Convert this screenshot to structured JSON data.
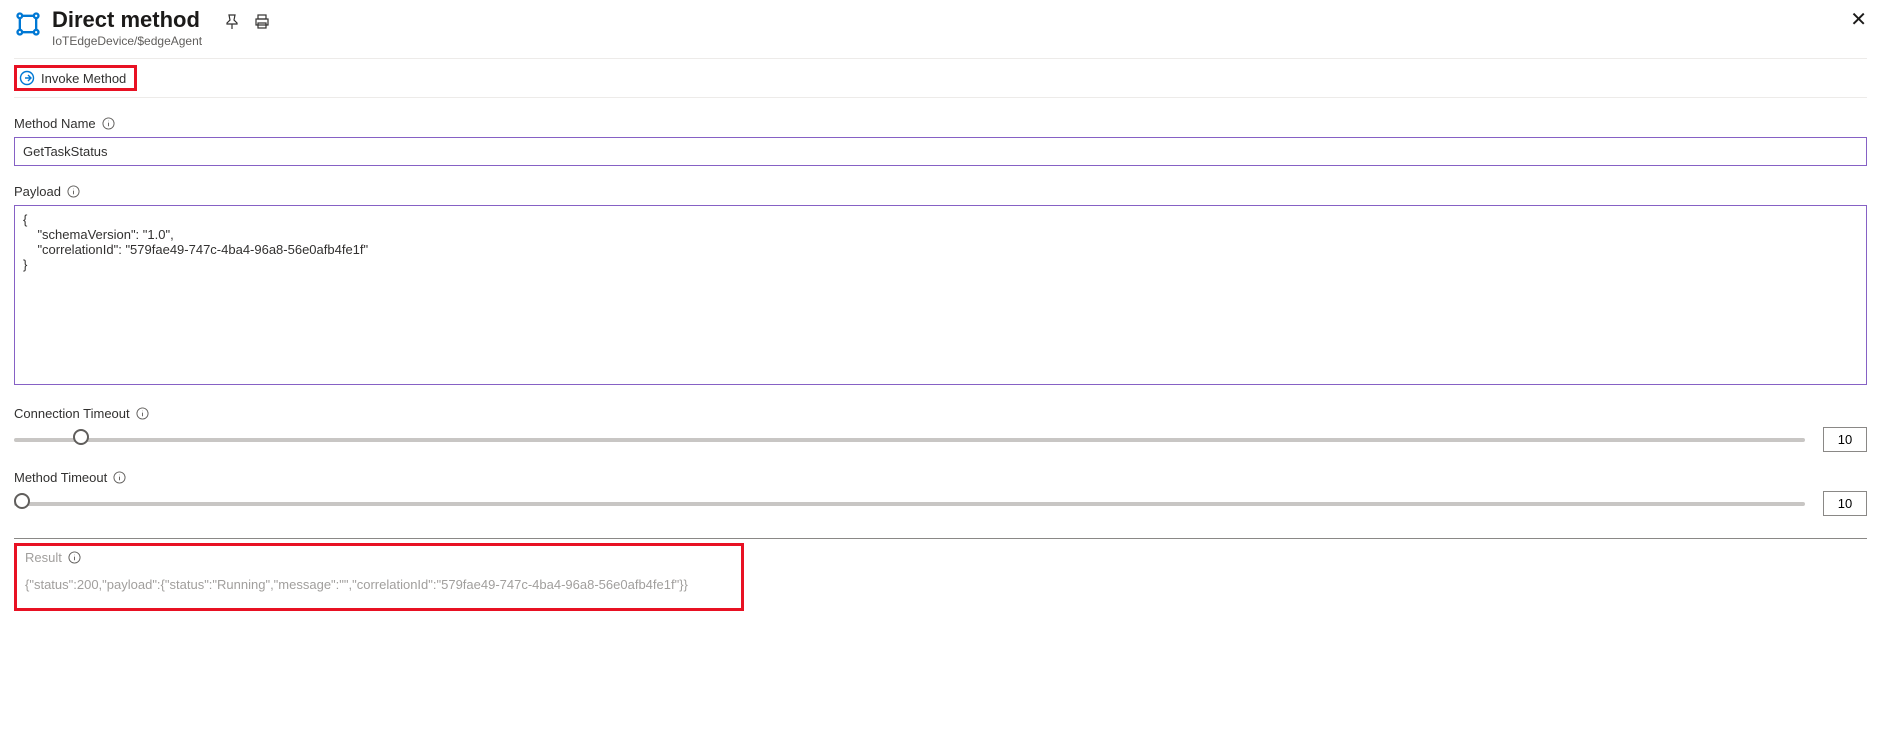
{
  "header": {
    "title": "Direct method",
    "subtitle": "IoTEdgeDevice/$edgeAgent"
  },
  "toolbar": {
    "invoke_label": "Invoke Method"
  },
  "fields": {
    "method_name_label": "Method Name",
    "method_name_value": "GetTaskStatus",
    "payload_label": "Payload",
    "payload_value": "{\n    \"schemaVersion\": \"1.0\",\n    \"correlationId\": \"579fae49-747c-4ba4-96a8-56e0afb4fe1f\"\n}",
    "connection_timeout_label": "Connection Timeout",
    "connection_timeout_value": "10",
    "method_timeout_label": "Method Timeout",
    "method_timeout_value": "10"
  },
  "result": {
    "label": "Result",
    "value": "{\"status\":200,\"payload\":{\"status\":\"Running\",\"message\":\"\",\"correlationId\":\"579fae49-747c-4ba4-96a8-56e0afb4fe1f\"}}"
  }
}
